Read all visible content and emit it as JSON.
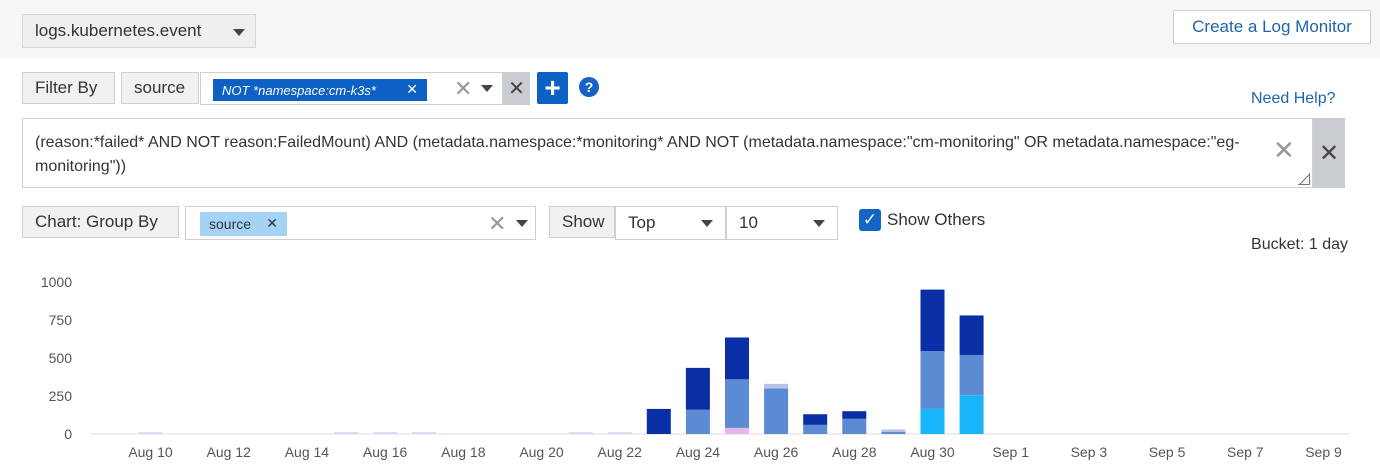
{
  "source_select": {
    "value": "logs.kubernetes.event"
  },
  "create_monitor_label": "Create a Log Monitor",
  "filter": {
    "label": "Filter By",
    "field": "source",
    "tag": "NOT *namespace:cm-k3s*",
    "tag_remove": "✕",
    "clear": "✕",
    "remove": "✕",
    "add": "+",
    "help": "?"
  },
  "need_help_label": "Need Help?",
  "query": {
    "text": "(reason:*failed* AND NOT reason:FailedMount) AND (metadata.namespace:*monitoring* AND NOT (metadata.namespace:\"cm-monitoring\" OR metadata.namespace:\"eg-monitoring\"))",
    "clear": "✕",
    "remove": "✕"
  },
  "group_by": {
    "label": "Chart: Group By",
    "tag": "source",
    "tag_remove": "✕",
    "clear": "✕"
  },
  "show": {
    "label": "Show",
    "order": "Top",
    "count": "10",
    "others_label": "Show Others",
    "others_checked": true,
    "check": "✓"
  },
  "bucket_label": "Bucket: 1 day",
  "colors": {
    "accent": "#0d60c4",
    "navy": "#0a2ea6",
    "steel": "#5b8bd3",
    "sky": "#19b5fb",
    "faint": "#d9dcf7"
  },
  "chart_data": {
    "type": "bar",
    "stacked": true,
    "ylim": [
      0,
      1000
    ],
    "yticks": [
      "0",
      "250",
      "500",
      "750",
      "1000"
    ],
    "xtick_labels": [
      "Aug 10",
      "Aug 12",
      "Aug 14",
      "Aug 16",
      "Aug 18",
      "Aug 20",
      "Aug 22",
      "Aug 24",
      "Aug 26",
      "Aug 28",
      "Aug 30",
      "Sep 1",
      "Sep 3",
      "Sep 5",
      "Sep 7",
      "Sep 9"
    ],
    "categories": [
      "Aug 23",
      "Aug 24",
      "Aug 25",
      "Aug 26",
      "Aug 27",
      "Aug 28",
      "Aug 29",
      "Aug 30",
      "Aug 31"
    ],
    "series": [
      {
        "color": "#19b5fb",
        "values": [
          0,
          0,
          0,
          0,
          0,
          0,
          0,
          165,
          255
        ]
      },
      {
        "color": "#e7b8ec",
        "values": [
          0,
          0,
          40,
          0,
          0,
          0,
          0,
          0,
          0
        ]
      },
      {
        "color": "#5b8bd3",
        "values": [
          0,
          160,
          320,
          300,
          60,
          100,
          15,
          380,
          265
        ]
      },
      {
        "color": "#b8c3e6",
        "values": [
          0,
          0,
          0,
          30,
          0,
          0,
          15,
          0,
          0
        ]
      },
      {
        "color": "#0a2ea6",
        "values": [
          165,
          275,
          275,
          0,
          70,
          50,
          0,
          405,
          260
        ]
      }
    ],
    "faint_days": [
      "Aug 10",
      "Aug 15",
      "Aug 16",
      "Aug 17",
      "Aug 21",
      "Aug 22"
    ],
    "grid": false,
    "legend": "none"
  }
}
